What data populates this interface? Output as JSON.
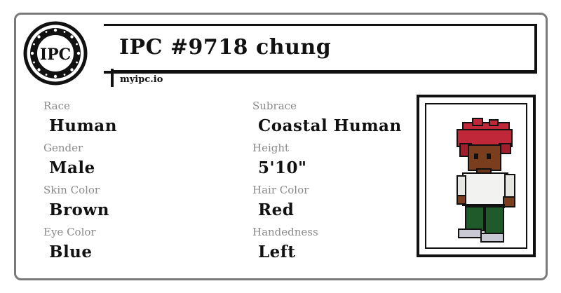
{
  "header": {
    "logo_text": "IPC",
    "title": "IPC #9718 chung",
    "site": "myipc.io"
  },
  "fields": [
    {
      "label": "Race",
      "value": "Human"
    },
    {
      "label": "Subrace",
      "value": "Coastal Human"
    },
    {
      "label": "Gender",
      "value": "Male"
    },
    {
      "label": "Height",
      "value": "5'10\""
    },
    {
      "label": "Skin Color",
      "value": "Brown"
    },
    {
      "label": "Hair Color",
      "value": "Red"
    },
    {
      "label": "Eye Color",
      "value": "Blue"
    },
    {
      "label": "Handedness",
      "value": "Left"
    }
  ],
  "portrait": {
    "icon": "pixel-character-icon",
    "colors": {
      "hair": "#c0283a",
      "skin": "#7a3e1e",
      "shirt": "#f2f2f0",
      "pants": "#1f5a2a",
      "shoes": "#c9c9d4"
    }
  }
}
